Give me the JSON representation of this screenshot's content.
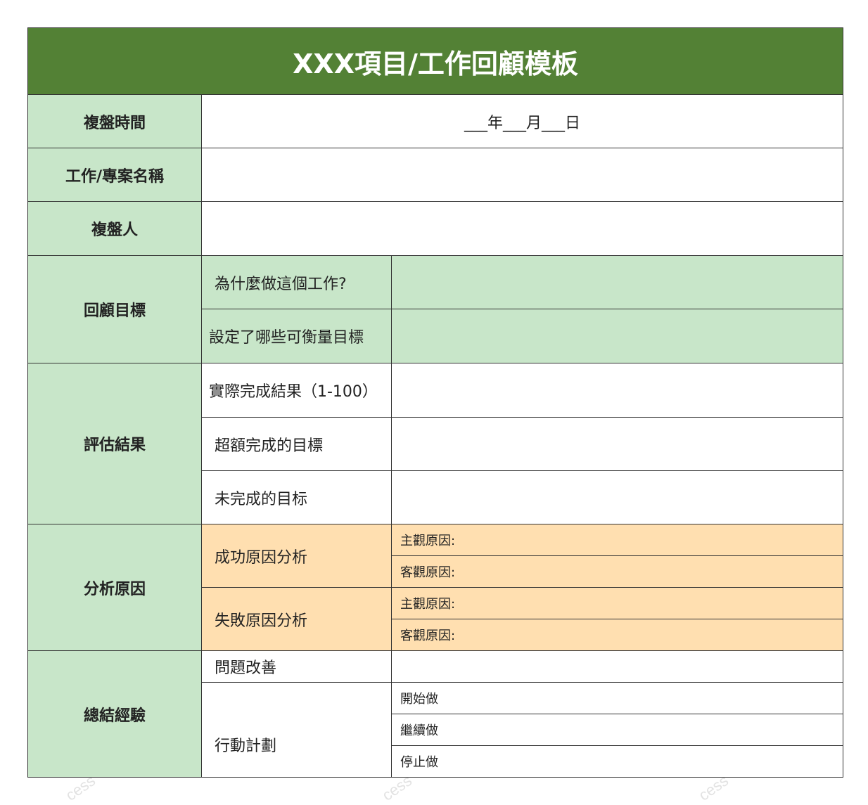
{
  "title": "XXX項目/工作回顧模板",
  "rows": {
    "review_time": {
      "label": "複盤時間",
      "value": "___年___月___日"
    },
    "project_name": {
      "label": "工作/專案名稱"
    },
    "reviewer": {
      "label": "複盤人"
    },
    "review_goals": {
      "label": "回顧目標",
      "items": [
        "為什麼做這個工作?",
        "設定了哪些可衡量目標"
      ]
    },
    "evaluate_results": {
      "label": "評估結果",
      "items": [
        "實際完成結果（1-100）",
        "超額完成的目標",
        "未完成的目标"
      ]
    },
    "analyze_causes": {
      "label": "分析原因",
      "success": {
        "label": "成功原因分析",
        "subjective": "主觀原因:",
        "objective": "客觀原因:"
      },
      "failure": {
        "label": "失敗原因分析",
        "subjective": "主觀原因:",
        "objective": "客觀原因:"
      }
    },
    "summary": {
      "label": "總結經驗",
      "improve": "問題改善",
      "action_plan": "行動計劃",
      "actions": [
        "開始做",
        "繼續做",
        "停止做"
      ]
    }
  },
  "watermark": "cess",
  "colors": {
    "header_green": "#538135",
    "label_green": "#c8e6c9",
    "cause_peach": "#ffdfb0"
  }
}
